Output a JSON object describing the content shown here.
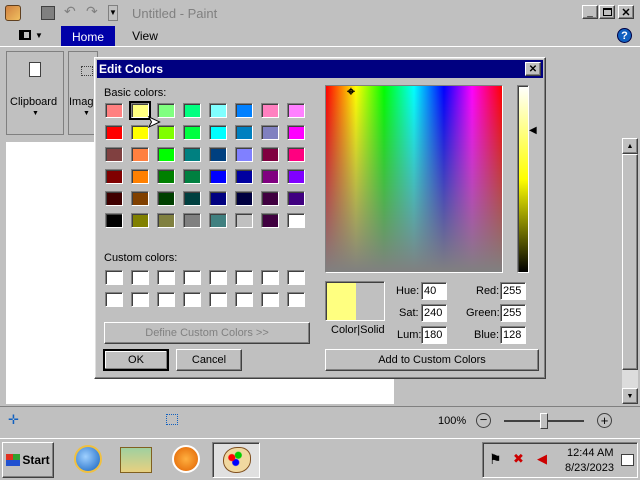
{
  "paint": {
    "title": "Untitled - Paint",
    "tabs": [
      "Home",
      "View"
    ],
    "groups": {
      "clipboard": "Clipboard",
      "image": "Imag"
    },
    "zoom": "100%"
  },
  "dialog": {
    "title": "Edit Colors",
    "basic_label": "Basic colors:",
    "custom_label": "Custom colors:",
    "define_btn": "Define Custom Colors >>",
    "ok": "OK",
    "cancel": "Cancel",
    "add_btn": "Add to Custom Colors",
    "color_solid": "Color|Solid",
    "fields": {
      "hue": {
        "label": "Hue:",
        "value": "40"
      },
      "sat": {
        "label": "Sat:",
        "value": "240"
      },
      "lum": {
        "label": "Lum:",
        "value": "180"
      },
      "red": {
        "label": "Red:",
        "value": "255"
      },
      "green": {
        "label": "Green:",
        "value": "255"
      },
      "blue": {
        "label": "Blue:",
        "value": "128"
      }
    },
    "current_color": "#ffff80",
    "basic_colors": [
      "#ff8080",
      "#ffff80",
      "#80ff80",
      "#00ff80",
      "#80ffff",
      "#0080ff",
      "#ff80c0",
      "#ff80ff",
      "#ff0000",
      "#ffff00",
      "#80ff00",
      "#00ff40",
      "#00ffff",
      "#0080c0",
      "#8080c0",
      "#ff00ff",
      "#804040",
      "#ff8040",
      "#00ff00",
      "#008080",
      "#004080",
      "#8080ff",
      "#800040",
      "#ff0080",
      "#800000",
      "#ff8000",
      "#008000",
      "#008040",
      "#0000ff",
      "#0000a0",
      "#800080",
      "#8000ff",
      "#400000",
      "#804000",
      "#004000",
      "#004040",
      "#000080",
      "#000040",
      "#400040",
      "#400080",
      "#000000",
      "#808000",
      "#808040",
      "#808080",
      "#408080",
      "#c0c0c0",
      "#400040",
      "#ffffff"
    ]
  },
  "taskbar": {
    "start": "Start",
    "time": "12:44 AM",
    "date": "8/23/2023"
  }
}
